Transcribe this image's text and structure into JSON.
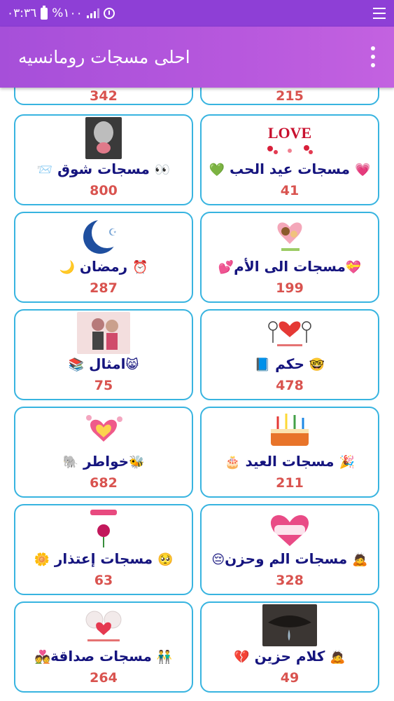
{
  "status": {
    "time": "٠٣:٣٦",
    "battery": "%١٠٠"
  },
  "appbar": {
    "title": "احلى مسجات رومانسيه"
  },
  "partial_row": [
    {
      "count": "215"
    },
    {
      "count": "342"
    }
  ],
  "cards": [
    {
      "title": "مسجات عيد الحب",
      "emoji_before": "💗",
      "emoji_after": "💚",
      "count": "41",
      "image": "love-image"
    },
    {
      "title": "مسجات شوق",
      "emoji_before": "👀",
      "emoji_after": "📨",
      "count": "800",
      "image": "rose-kiss-image"
    },
    {
      "title": "مسجات الى الأم",
      "emoji_before": "💝",
      "emoji_after": "💕",
      "count": "199",
      "image": "mother-child-image"
    },
    {
      "title": "رمضان",
      "emoji_before": "⏰",
      "emoji_after": "🌙",
      "count": "287",
      "image": "crescent-moon-image"
    },
    {
      "title": "حكم",
      "emoji_before": "🤓",
      "emoji_after": "📘",
      "count": "478",
      "image": "hearts-couple-image"
    },
    {
      "title": "امثال",
      "emoji_before": "😸",
      "emoji_after": "📚",
      "count": "75",
      "image": "couple-image"
    },
    {
      "title": "مسجات العيد",
      "emoji_before": "🎉",
      "emoji_after": "🎂",
      "count": "211",
      "image": "birthday-cake-image"
    },
    {
      "title": "خواطر",
      "emoji_before": "🐝",
      "emoji_after": "🐘",
      "count": "682",
      "image": "hearts-heart-image"
    },
    {
      "title": "مسجات الم وحزن",
      "emoji_before": "🙇",
      "emoji_after": "😔",
      "count": "328",
      "image": "habibi-image"
    },
    {
      "title": "مسجات إعتذار",
      "emoji_before": "🥺",
      "emoji_after": "🌼",
      "count": "63",
      "image": "apology-rose-image"
    },
    {
      "title": "كلام حزين",
      "emoji_before": "🙇",
      "emoji_after": "💔",
      "count": "49",
      "image": "tear-eye-image"
    },
    {
      "title": "مسجات صداقة",
      "emoji_before": "👬",
      "emoji_after": "💑",
      "count": "264",
      "image": "teddy-heart-image"
    }
  ]
}
